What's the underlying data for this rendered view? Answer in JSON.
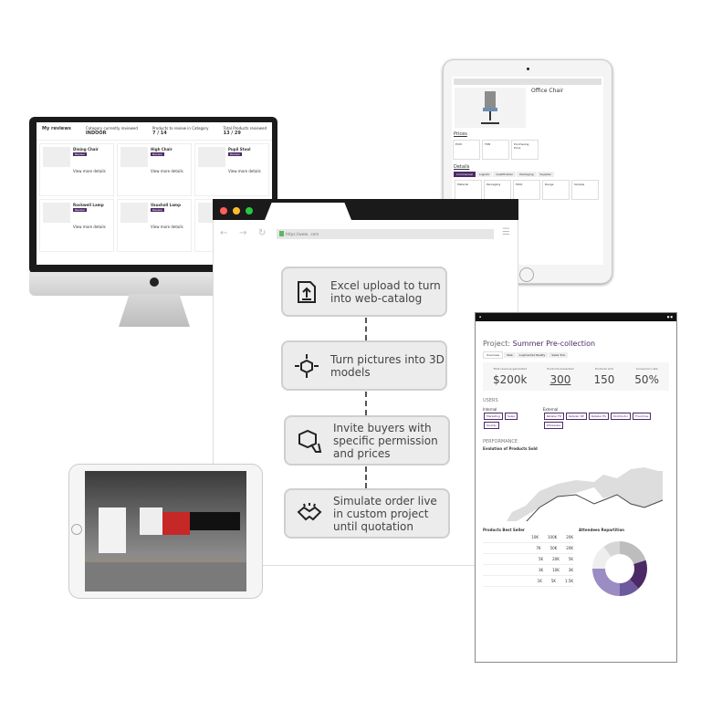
{
  "colors": {
    "accent": "#4b2a66",
    "mac_red": "#ff5f56",
    "mac_yellow": "#ffbd2e",
    "mac_green": "#27c93f"
  },
  "desktop": {
    "title": "My reviews",
    "category_label": "Category currently reviewed",
    "category_value": "INDOOR",
    "products_in_category_label": "Products to review in Category",
    "products_in_category": "7 / 14",
    "total_label": "Total Products reviewed",
    "total": "13 / 29",
    "products": [
      {
        "name": "Dining Chair"
      },
      {
        "name": "High Chair"
      },
      {
        "name": "Pupil Stool"
      },
      {
        "name": "Rockwell Lamp"
      },
      {
        "name": "Vauxhall Lamp"
      },
      {
        "name": ""
      }
    ],
    "review_label": "Review",
    "more_label": "View more details"
  },
  "tablet": {
    "product_name": "Office Chair",
    "prices_heading": "Prices",
    "prices": [
      "EXW",
      "FOB",
      "Purchasing Price"
    ],
    "details_heading": "Details",
    "tabs": [
      "Commercial",
      "Logistic",
      "Qualification",
      "Packaging",
      "Supplier"
    ],
    "detail_cols": [
      "Material",
      "Packaging",
      "MOQ",
      "Range",
      "Sample"
    ]
  },
  "browser": {
    "url": "https://www.                .com",
    "steps": [
      {
        "icon": "upload-icon",
        "text": "Excel upload to turn into web-catalog"
      },
      {
        "icon": "3d-cube-icon",
        "text": "Turn pictures into 3D models"
      },
      {
        "icon": "box-hand-icon",
        "text": "Invite buyers with specific permission and prices"
      },
      {
        "icon": "handshake-icon",
        "text": "Simulate order live in custom project until quotation"
      }
    ]
  },
  "dashboard": {
    "project_label": "Project:",
    "project_name": "Summer Pre-collection",
    "tabs": [
      "Overview",
      "Web",
      "Augmented Reality",
      "Sales Tool"
    ],
    "kpis": [
      {
        "label": "Total revenue generated",
        "value": "$200k"
      },
      {
        "label": "Products presented",
        "value": "300"
      },
      {
        "label": "Products sold",
        "value": "150"
      },
      {
        "label": "Conversion rate",
        "value": "50%"
      }
    ],
    "users_heading": "USERS",
    "internal_label": "Internal",
    "external_label": "External",
    "internal": [
      "Marketing",
      "Sales",
      "Quality"
    ],
    "external": [
      "Retailer FR",
      "Retailer DE",
      "Retailer ES",
      "Distributor",
      "Franchise",
      "Wholesale"
    ],
    "performance_heading": "PERFORMANCE",
    "chart_title": "Evolution of Products Sold",
    "best_seller_title": "Products Best Seller",
    "repartition_title": "Attendees Repartition",
    "best_seller_rows": [
      [
        "10K",
        "100K",
        "20K"
      ],
      [
        "7K",
        "50K",
        "20K"
      ],
      [
        "5K",
        "20K",
        "5K"
      ],
      [
        "3K",
        "10K",
        "3K"
      ],
      [
        "1K",
        "5K",
        "1.5K"
      ]
    ],
    "donut": [
      20,
      18,
      12,
      25,
      15,
      10
    ]
  },
  "ar_tablet": {}
}
